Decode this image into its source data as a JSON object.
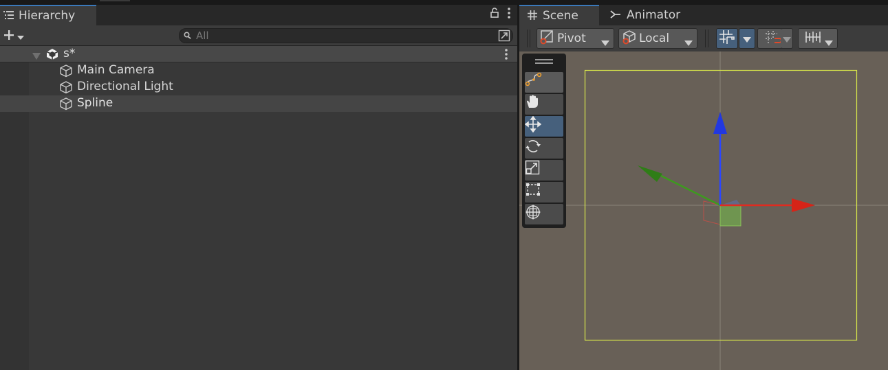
{
  "hierarchy": {
    "tab_label": "Hierarchy",
    "search": {
      "value": "",
      "placeholder": "All"
    },
    "scene": {
      "name": "s*"
    },
    "items": [
      {
        "label": "Main Camera",
        "selected": false
      },
      {
        "label": "Directional Light",
        "selected": false
      },
      {
        "label": "Spline",
        "selected": true
      }
    ]
  },
  "scene_view": {
    "tabs": [
      {
        "label": "Scene",
        "icon": "grid-hash-icon",
        "active": true
      },
      {
        "label": "Animator",
        "icon": "animator-icon",
        "active": false
      }
    ],
    "toolbar": {
      "pivot_label": "Pivot",
      "local_label": "Local"
    },
    "tools": [
      {
        "name": "spline-draw-tool",
        "icon": "spline-pen-icon",
        "active": false
      },
      {
        "name": "hand-tool",
        "icon": "hand-icon",
        "active": false
      },
      {
        "name": "move-tool",
        "icon": "move-arrows-icon",
        "active": true
      },
      {
        "name": "rotate-tool",
        "icon": "rotate-icon",
        "active": false
      },
      {
        "name": "scale-tool",
        "icon": "scale-icon",
        "active": false
      },
      {
        "name": "rect-tool",
        "icon": "rect-transform-icon",
        "active": false
      },
      {
        "name": "transform-tool",
        "icon": "transform-all-icon",
        "active": false
      }
    ],
    "colors": {
      "viewport_bg": "#686057",
      "selection_accent": "#3a79bb",
      "axis_x": "#e02b20",
      "axis_y": "#2a46ff",
      "axis_z": "#3d9a1e",
      "frame": "#d9e84a"
    }
  }
}
